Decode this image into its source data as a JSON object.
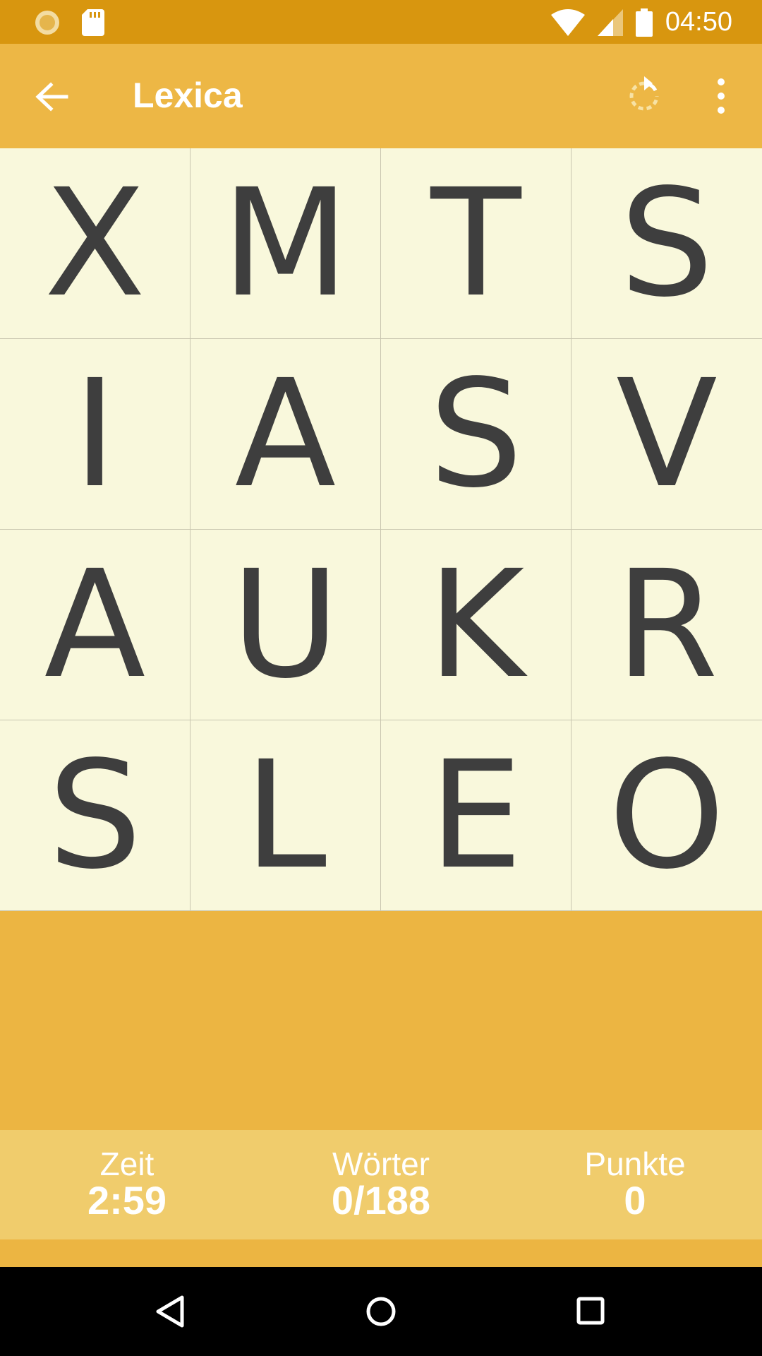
{
  "status_bar": {
    "time": "04:50",
    "icons": [
      "loading-icon",
      "sd-card-icon",
      "wifi-icon",
      "signal-icon",
      "battery-icon"
    ]
  },
  "app_bar": {
    "title": "Lexica",
    "icons": [
      "back-arrow-icon",
      "refresh-icon",
      "more-vert-icon"
    ]
  },
  "board": {
    "tiles": [
      "X",
      "M",
      "T",
      "S",
      "I",
      "A",
      "S",
      "V",
      "A",
      "U",
      "K",
      "R",
      "S",
      "L",
      "E",
      "O"
    ]
  },
  "stats": {
    "time_label": "Zeit",
    "time_value": "2:59",
    "words_label": "Wörter",
    "words_value": "0/188",
    "points_label": "Punkte",
    "points_value": "0"
  },
  "nav_bar": {
    "icons": [
      "back-triangle-icon",
      "home-circle-icon",
      "recents-square-icon"
    ]
  },
  "colors": {
    "status_bar": "#D8960F",
    "app_bar": "#EDB745",
    "background": "#ECB542",
    "board": "#F9F8DC",
    "stats_bar": "#F0CC6C",
    "letter": "#3E3E3E"
  }
}
